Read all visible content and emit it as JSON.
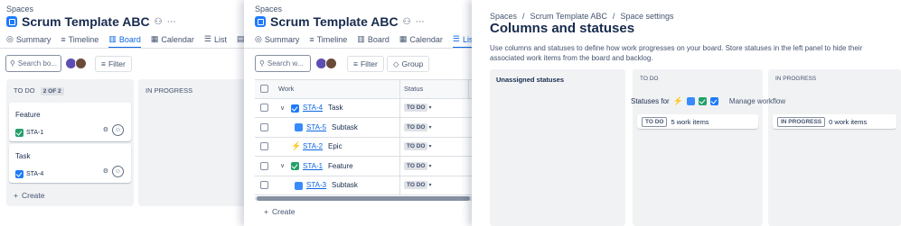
{
  "panel1": {
    "breadcrumb": "Spaces",
    "title": "Scrum Template ABC",
    "tabs": [
      {
        "label": "Summary",
        "icon": "globe-icon",
        "active": false
      },
      {
        "label": "Timeline",
        "icon": "timeline-icon",
        "active": false
      },
      {
        "label": "Board",
        "icon": "board-icon",
        "active": true
      },
      {
        "label": "Calendar",
        "icon": "calendar-icon",
        "active": false
      },
      {
        "label": "List",
        "icon": "list-icon",
        "active": false
      },
      {
        "label": "F",
        "icon": "form-icon",
        "active": false
      }
    ],
    "search_placeholder": "Search bo...",
    "filter_label": "Filter",
    "columns": [
      {
        "name": "TO DO",
        "count": "2 OF 2"
      },
      {
        "name": "IN PROGRESS"
      }
    ],
    "cards": [
      {
        "title": "Feature",
        "key": "STA-1",
        "type": "story"
      },
      {
        "title": "Task",
        "key": "STA-4",
        "type": "task"
      }
    ],
    "create_label": "Create"
  },
  "panel2": {
    "breadcrumb": "Spaces",
    "title": "Scrum Template ABC",
    "tabs": [
      {
        "label": "Summary",
        "active": false
      },
      {
        "label": "Timeline",
        "active": false
      },
      {
        "label": "Board",
        "active": false
      },
      {
        "label": "Calendar",
        "active": false
      },
      {
        "label": "Lis",
        "active": true
      }
    ],
    "search_placeholder": "Search w...",
    "filter_label": "Filter",
    "group_label": "Group",
    "headers": {
      "work": "Work",
      "status": "Status"
    },
    "rows": [
      {
        "key": "STA-4",
        "summary": "Task",
        "status": "TO DO",
        "type": "task",
        "expand": true,
        "indent": false
      },
      {
        "key": "STA-5",
        "summary": "Subtask",
        "status": "TO DO",
        "type": "subtask",
        "expand": false,
        "indent": true
      },
      {
        "key": "STA-2",
        "summary": "Epic",
        "status": "TO DO",
        "type": "epic",
        "expand": false,
        "indent": false
      },
      {
        "key": "STA-1",
        "summary": "Feature",
        "status": "TO DO",
        "type": "story",
        "expand": true,
        "indent": false
      },
      {
        "key": "STA-3",
        "summary": "Subtask",
        "status": "TO DO",
        "type": "subtask",
        "expand": false,
        "indent": true
      }
    ],
    "create_label": "Create"
  },
  "panel3": {
    "breadcrumb": [
      "Spaces",
      "Scrum Template ABC",
      "Space settings"
    ],
    "title": "Columns and statuses",
    "description": "Use columns and statuses to define how work progresses on your board. Store statuses in the left panel to hide their associated work items from the board and backlog.",
    "unassigned_label": "Unassigned statuses",
    "columns": [
      {
        "name": "TO DO"
      },
      {
        "name": "IN PROGRESS"
      }
    ],
    "statuses_for_label": "Statuses for",
    "manage_workflow_label": "Manage workflow",
    "status_boxes": [
      {
        "status": "TO DO",
        "count_text": "5 work items"
      },
      {
        "status": "IN PROGRESS",
        "count_text": "0 work items"
      }
    ]
  }
}
